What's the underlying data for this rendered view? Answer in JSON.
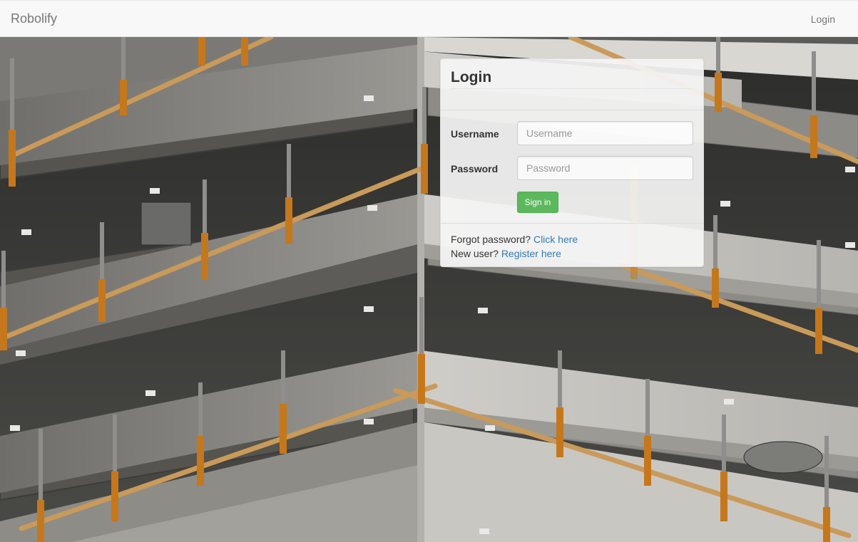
{
  "navbar": {
    "brand": "Robolify",
    "login_link": "Login"
  },
  "login_panel": {
    "title": "Login",
    "username_label": "Username",
    "username_placeholder": "Username",
    "username_value": "",
    "password_label": "Password",
    "password_placeholder": "Password",
    "password_value": "",
    "signin_label": "Sign in",
    "forgot_text": "Forgot password?",
    "forgot_link": "Click here",
    "newuser_text": "New user?",
    "register_link": "Register here"
  },
  "colors": {
    "navbar_bg": "#f8f8f8",
    "signin_button": "#5cb85c",
    "link": "#337ab7"
  }
}
